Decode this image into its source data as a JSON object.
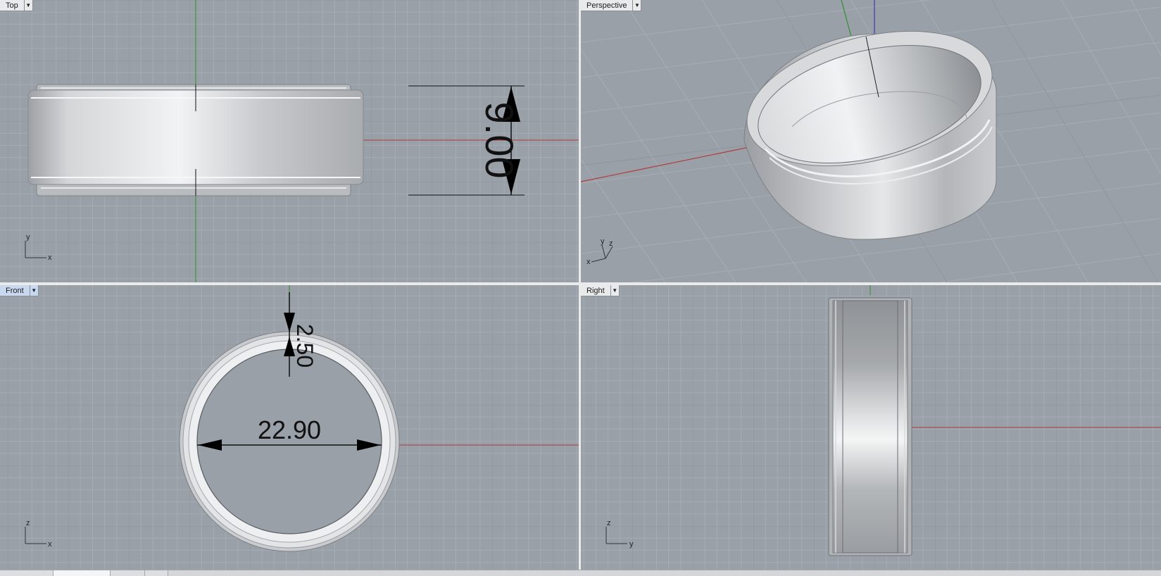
{
  "viewports": {
    "top": {
      "label": "Top",
      "dimension": "9.00",
      "axis_labels": [
        "y",
        "x"
      ]
    },
    "perspective": {
      "label": "Perspective",
      "axis_labels": [
        "y",
        "z",
        "x"
      ]
    },
    "front": {
      "label": "Front",
      "dimension_width": "22.90",
      "dimension_thickness": "2.50",
      "axis_labels": [
        "z",
        "x"
      ]
    },
    "right": {
      "label": "Right",
      "axis_labels": [
        "z",
        "y"
      ]
    }
  },
  "active_viewport": "front",
  "dropdown_icon": "triangle-down-icon",
  "colors": {
    "viewport_bg": "#9aa0a8",
    "grid_minor": "#a6acb3",
    "grid_major": "#8d939b",
    "x_axis": "#b03a3a",
    "y_axis": "#2f8f2f",
    "z_axis": "#3a3ab0",
    "dimension": "#000000"
  },
  "bottom_tabs": [
    "",
    "",
    "",
    ""
  ]
}
